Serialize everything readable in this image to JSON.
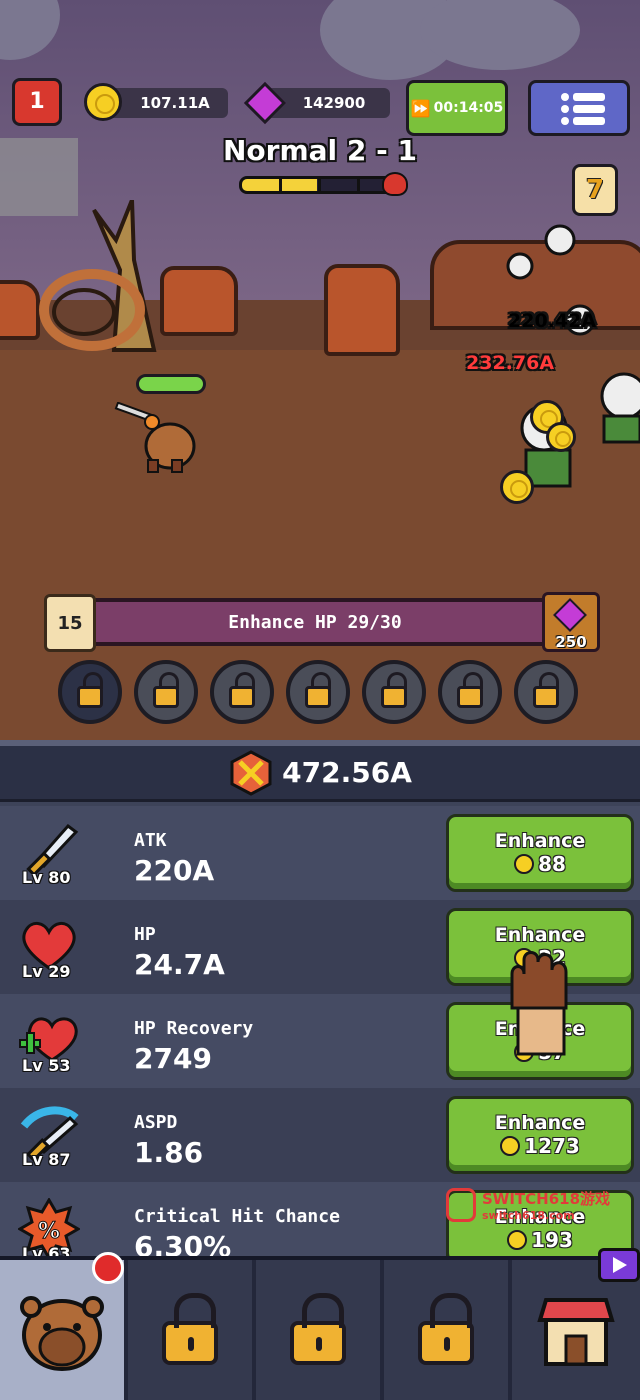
{
  "hud": {
    "level_badge": "1",
    "gold": "107.11A",
    "gems": "142900",
    "timer": "00:14:05",
    "calendar_day": "7"
  },
  "stage": {
    "title": "Normal 2 - 1",
    "progress_segments_filled": 2,
    "progress_segments_total": 4
  },
  "damage_numbers": [
    {
      "text": "220.42A",
      "color": "#ffffff"
    },
    {
      "text": "232.76A",
      "color": "#ff3b3b"
    }
  ],
  "quest": {
    "number": "15",
    "label": "Enhance HP 29/30",
    "reward": "250"
  },
  "power": {
    "value": "472.56A"
  },
  "stats": [
    {
      "name": "ATK",
      "level": "Lv 80",
      "value": "220A",
      "button": "Enhance",
      "cost": "88"
    },
    {
      "name": "HP",
      "level": "Lv 29",
      "value": "24.7A",
      "button": "Enhance",
      "cost": "22"
    },
    {
      "name": "HP Recovery",
      "level": "Lv 53",
      "value": "2749",
      "button": "Enhance",
      "cost": "57"
    },
    {
      "name": "ASPD",
      "level": "Lv 87",
      "value": "1.86",
      "button": "Enhance",
      "cost": "1273"
    },
    {
      "name": "Critical Hit Chance",
      "level": "Lv 63",
      "value": "6.30%",
      "button": "Enhance",
      "cost": "193"
    }
  ],
  "watermark": {
    "text": "SWITCH618游戏",
    "sub": "switch618.com"
  },
  "nav": {
    "tabs": [
      "character",
      "locked",
      "locked",
      "locked",
      "shop"
    ]
  },
  "colors": {
    "enhance_button": "#7bc13b",
    "damage_crit": "#ff3b3b",
    "quest_bar": "#7b3e68"
  }
}
